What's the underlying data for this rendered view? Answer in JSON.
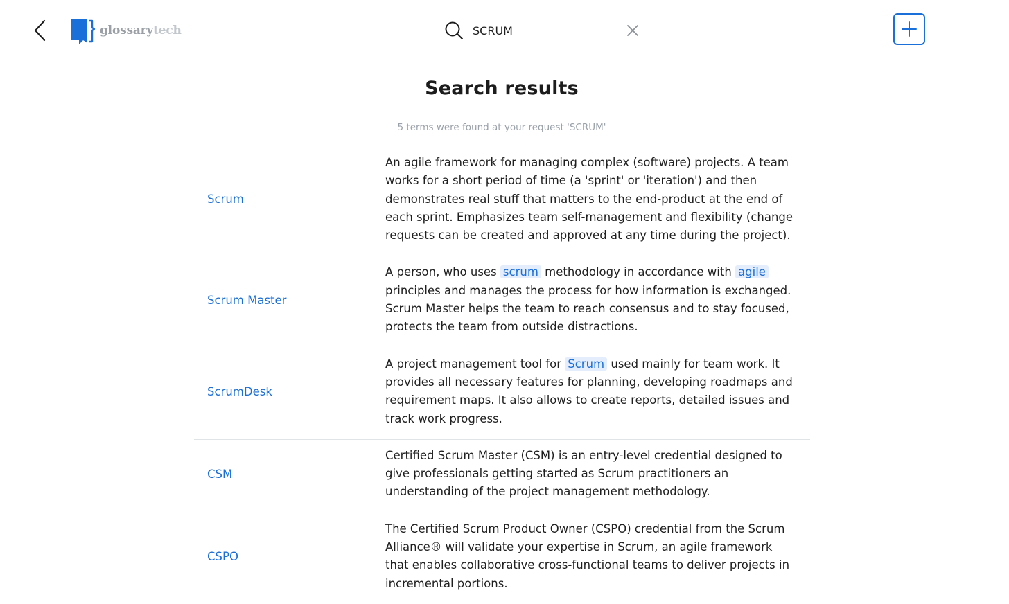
{
  "header": {
    "logo": {
      "text_primary": "glossary",
      "text_secondary": "tech",
      "icon": "bookmark-logo-icon"
    },
    "back_icon": "chevron-left-icon",
    "search": {
      "icon": "search-icon",
      "value": "SCRUM",
      "clear_icon": "close-icon"
    },
    "add_icon": "plus-icon"
  },
  "title": "Search results",
  "summary": "5 terms were found at your request 'SCRUM'",
  "colors": {
    "accent": "#1b6fd8",
    "highlight_bg": "#e3edfb",
    "divider": "#e1e4e7",
    "muted_text": "#9aa1a8"
  },
  "results": [
    {
      "term": "Scrum",
      "definition": [
        {
          "text": "An agile framework for managing complex (software) projects. A team works for a short period of time (a 'sprint' or 'iteration') and then demonstrates real stuff that matters to the end-product at the end of each sprint. Emphasizes team self-management and flexibility (change requests can be created and approved at any time during the project)."
        }
      ]
    },
    {
      "term": "Scrum Master",
      "definition": [
        {
          "text": "A person, who uses "
        },
        {
          "text": "scrum",
          "link": true
        },
        {
          "text": " methodology in accordance with "
        },
        {
          "text": "agile",
          "link": true
        },
        {
          "text": " principles and manages the process for how information is exchanged. Scrum Master helps the team to reach consensus and to stay focused, protects the team from outside distractions."
        }
      ]
    },
    {
      "term": "ScrumDesk",
      "definition": [
        {
          "text": "A project management tool for "
        },
        {
          "text": "Scrum",
          "link": true
        },
        {
          "text": " used mainly for team work. It provides all necessary features for planning, developing roadmaps and requirement maps. It also allows to create reports, detailed issues and track work progress."
        }
      ]
    },
    {
      "term": "CSM",
      "definition": [
        {
          "text": "Certified Scrum Master (CSM) is an entry-level credential designed to give professionals getting started as Scrum practitioners an understanding of the project management methodology."
        }
      ]
    },
    {
      "term": "CSPO",
      "definition": [
        {
          "text": "The Certified Scrum Product Owner (CSPO) credential from the Scrum Alliance® will validate your expertise in Scrum, an agile framework that enables collaborative cross-functional teams to deliver projects in incremental portions."
        }
      ]
    }
  ]
}
